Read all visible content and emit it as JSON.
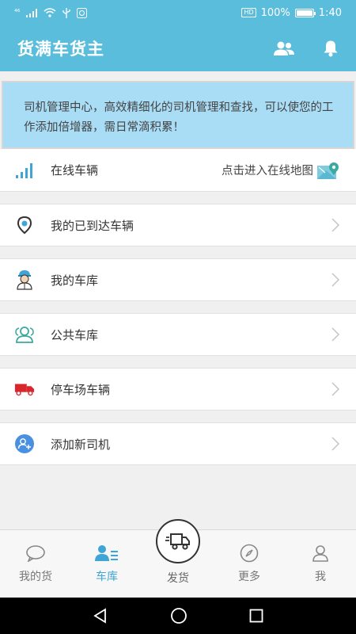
{
  "status_bar": {
    "network": "⁴⁶",
    "hd": "HD",
    "battery_text": "100%",
    "battery_level": 1.0,
    "time": "1:40"
  },
  "header": {
    "title": "货满车货主"
  },
  "notice": {
    "text": "司机管理中心，高效精细化的司机管理和查找，可以使您的工作添加倍增器，需日常滴积累！"
  },
  "menu": {
    "online": {
      "label": "在线车辆",
      "hint": "点击进入在线地图"
    },
    "arrived": {
      "label": "我的已到达车辆"
    },
    "my_garage": {
      "label": "我的车库"
    },
    "public_garage": {
      "label": "公共车库"
    },
    "parking": {
      "label": "停车场车辆"
    },
    "add_driver": {
      "label": "添加新司机"
    }
  },
  "tabs": {
    "my_goods": "我的货",
    "garage": "车库",
    "ship": "发货",
    "more": "更多",
    "me": "我"
  },
  "colors": {
    "primary": "#5bbddc",
    "notice_bg": "#a9dcf5",
    "active_tab": "#3ea5d6",
    "truck_red": "#d9262c",
    "teal": "#3aa9a0"
  }
}
